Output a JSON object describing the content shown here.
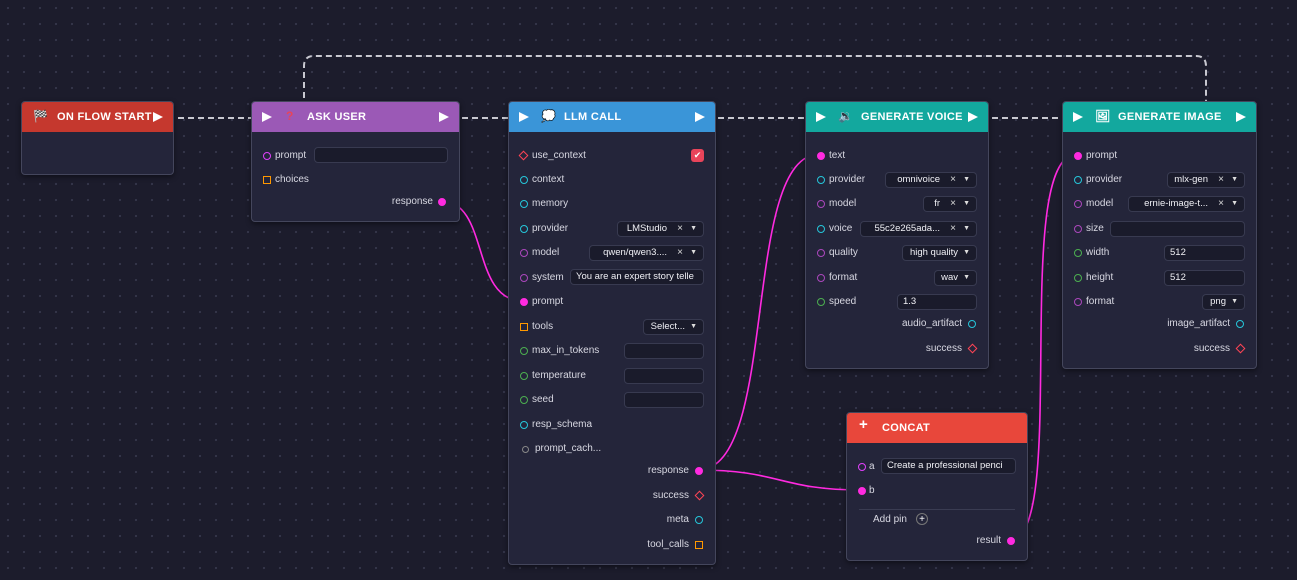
{
  "colors": {
    "wire_exec": "#c8c8d0",
    "wire_data": "#ff2ae0",
    "start": "#c5382e",
    "ask": "#9b59b6",
    "llm": "#3a95d8",
    "voice": "#13a89e",
    "image": "#13a89e",
    "concat": "#e8473b"
  },
  "nodes": {
    "start": {
      "title": "ON FLOW START",
      "icon": "checkered-flag-icon"
    },
    "ask": {
      "title": "ASK USER",
      "icon": "question-mark-icon",
      "prompt_label": "prompt",
      "prompt_value": "",
      "choices_label": "choices",
      "response_label": "response"
    },
    "llm": {
      "title": "LLM CALL",
      "icon": "thought-bubble-icon",
      "use_context": "use_context",
      "context": "context",
      "memory": "memory",
      "provider_label": "provider",
      "provider_value": "LMStudio",
      "model_label": "model",
      "model_value": "qwen/qwen3....",
      "system_label": "system",
      "system_value": "You are an expert story telle",
      "prompt_label": "prompt",
      "tools_label": "tools",
      "tools_value": "Select...",
      "max_tokens_label": "max_in_tokens",
      "temperature_label": "temperature",
      "seed_label": "seed",
      "resp_schema_label": "resp_schema",
      "prompt_cache_label": "prompt_cach...",
      "response_label": "response",
      "success_label": "success",
      "meta_label": "meta",
      "tool_calls_label": "tool_calls"
    },
    "voice": {
      "title": "GENERATE VOICE",
      "icon": "speaker-icon",
      "text_label": "text",
      "provider_label": "provider",
      "provider_value": "omnivoice",
      "model_label": "model",
      "model_value": "fr",
      "voice_label": "voice",
      "voice_value": "55c2e265ada...",
      "quality_label": "quality",
      "quality_value": "high quality",
      "format_label": "format",
      "format_value": "wav",
      "speed_label": "speed",
      "speed_value": "1.3",
      "audio_artifact_label": "audio_artifact",
      "success_label": "success"
    },
    "image": {
      "title": "GENERATE IMAGE",
      "icon": "picture-icon",
      "prompt_label": "prompt",
      "provider_label": "provider",
      "provider_value": "mlx-gen",
      "model_label": "model",
      "model_value": "ernie-image-t...",
      "size_label": "size",
      "size_value": "",
      "width_label": "width",
      "width_value": "512",
      "height_label": "height",
      "height_value": "512",
      "format_label": "format",
      "format_value": "png",
      "image_artifact_label": "image_artifact",
      "success_label": "success"
    },
    "concat": {
      "title": "CONCAT",
      "icon": "plus-icon",
      "a_label": "a",
      "a_value": "Create a professional penci",
      "b_label": "b",
      "add_pin_label": "Add pin",
      "result_label": "result"
    }
  }
}
